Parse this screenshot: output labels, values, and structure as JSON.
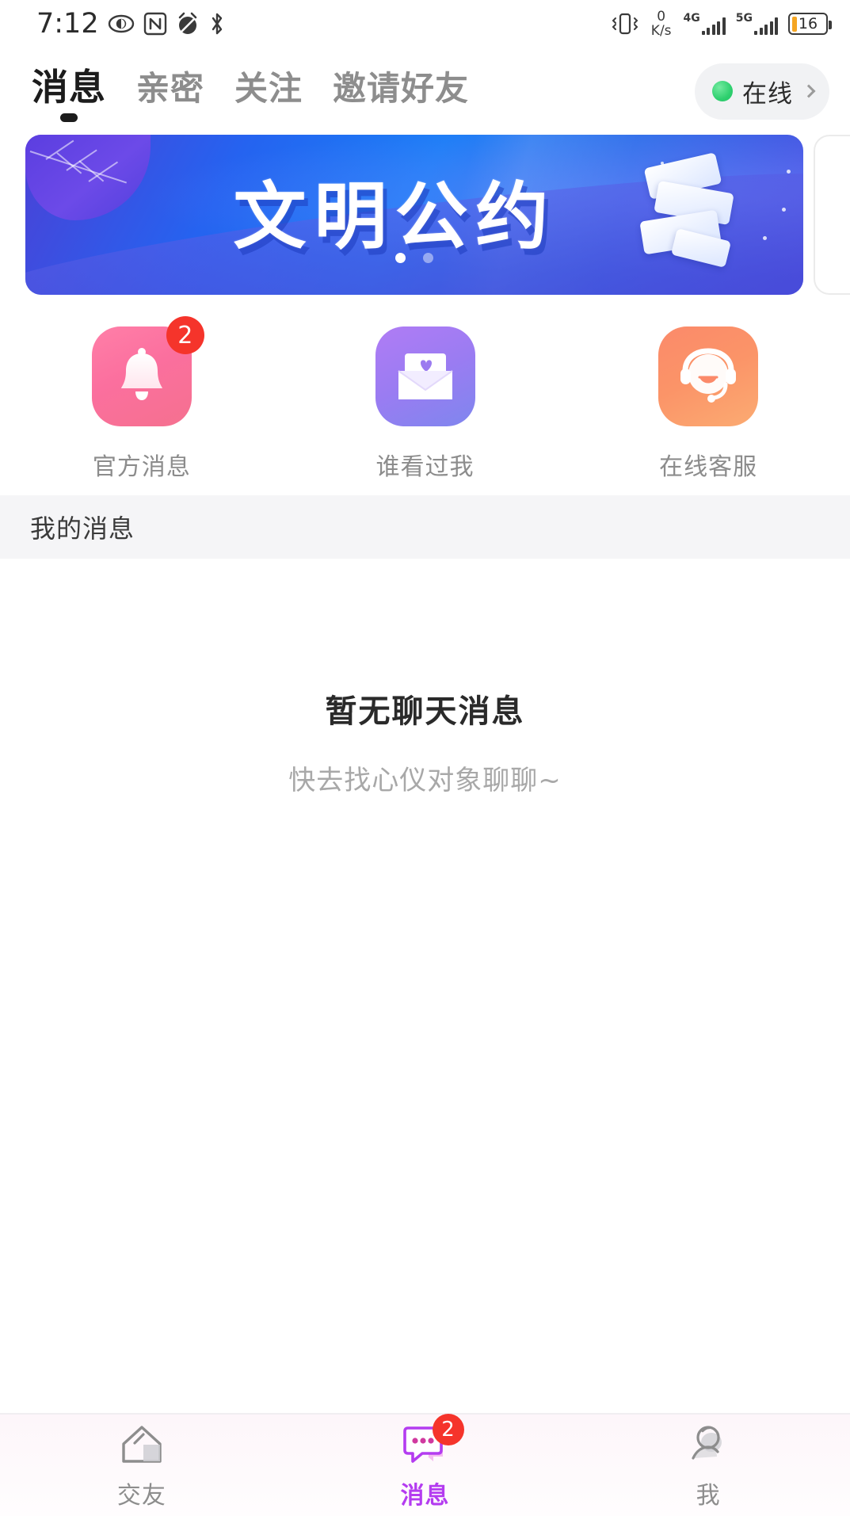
{
  "status_bar": {
    "time": "7:12",
    "left_icons": [
      "eye-icon",
      "nfc-icon",
      "alarm-mute-icon",
      "bluetooth-icon"
    ],
    "vibrate_icon": "vibrate-icon",
    "net_speed_value": "0",
    "net_speed_unit": "K/s",
    "sim1_network": "4G",
    "sim2_network": "5G",
    "battery_percent": "16"
  },
  "top_tabs": {
    "items": [
      {
        "label": "消息",
        "active": true
      },
      {
        "label": "亲密",
        "active": false
      },
      {
        "label": "关注",
        "active": false
      },
      {
        "label": "邀请好友",
        "active": false
      }
    ],
    "status_pill": {
      "label": "在线",
      "dot_color": "#2fd06f",
      "chevron": "chevron-right-icon"
    }
  },
  "banner": {
    "title": "文明公约",
    "dots": [
      true,
      false
    ],
    "gradient_start": "#4b41d6",
    "gradient_end": "#1b7ef6"
  },
  "shortcuts": [
    {
      "label": "官方消息",
      "icon": "bell-icon",
      "badge": "2",
      "color": "#fb6f9e"
    },
    {
      "label": "谁看过我",
      "icon": "envelope-heart-icon",
      "badge": "",
      "color": "#9a7cf2"
    },
    {
      "label": "在线客服",
      "icon": "headset-smile-icon",
      "badge": "",
      "color": "#fb9468"
    }
  ],
  "section": {
    "title": "我的消息"
  },
  "empty_state": {
    "title": "暂无聊天消息",
    "subtitle": "快去找心仪对象聊聊~"
  },
  "bottom_nav": {
    "items": [
      {
        "label": "交友",
        "icon": "home-icon",
        "active": false,
        "badge": ""
      },
      {
        "label": "消息",
        "icon": "chat-bubble-icon",
        "active": true,
        "badge": "2"
      },
      {
        "label": "我",
        "icon": "person-icon",
        "active": false,
        "badge": ""
      }
    ],
    "active_color": "#b43cf0"
  }
}
